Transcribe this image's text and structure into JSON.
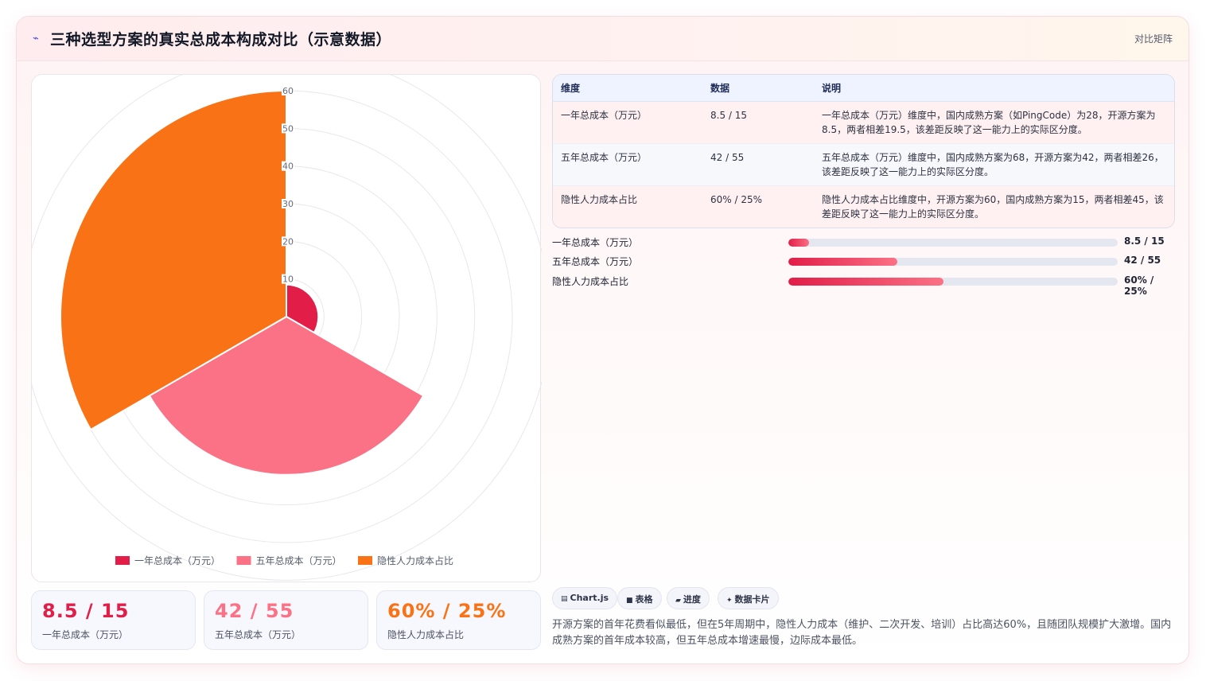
{
  "header": {
    "icon": "lightning-icon",
    "title": "三种选型方案的真实总成本构成对比（示意数据）",
    "badge": "对比矩阵"
  },
  "chart_data": {
    "type": "polarArea",
    "categories": [
      "一年总成本（万元）",
      "五年总成本（万元）",
      "隐性人力成本占比"
    ],
    "values": [
      8.5,
      42,
      60
    ],
    "colors": [
      "#e11d48",
      "#fb7185",
      "#f97316"
    ],
    "r_ticks": [
      "10",
      "20",
      "30",
      "40",
      "50",
      "60"
    ],
    "rlim": [
      0,
      60
    ],
    "legend": "bottom"
  },
  "table": {
    "headers": [
      "维度",
      "数据",
      "说明"
    ],
    "rows": [
      [
        "一年总成本（万元）",
        "8.5 / 15",
        "一年总成本（万元）维度中，国内成熟方案（如PingCode）为28，开源方案为8.5，两者相差19.5，该差距反映了这一能力上的实际区分度。"
      ],
      [
        "五年总成本（万元）",
        "42 / 55",
        "五年总成本（万元）维度中，国内成熟方案为68，开源方案为42，两者相差26，该差距反映了这一能力上的实际区分度。"
      ],
      [
        "隐性人力成本占比",
        "60% / 25%",
        "隐性人力成本占比维度中，开源方案为60，国内成熟方案为15，两者相差45，该差距反映了这一能力上的实际区分度。"
      ]
    ]
  },
  "progress": [
    {
      "label": "一年总成本（万元）",
      "value": "8.5 / 15",
      "fraction": 0.063
    },
    {
      "label": "五年总成本（万元）",
      "value": "42 / 55",
      "fraction": 0.33
    },
    {
      "label": "隐性人力成本占比",
      "value": "60% / 25%",
      "fraction": 0.47
    }
  ],
  "stats": [
    {
      "value": "8.5 / 15",
      "label": "一年总成本（万元）",
      "color": "#e11d48"
    },
    {
      "value": "42 / 55",
      "label": "五年总成本（万元）",
      "color": "#fb7185"
    },
    {
      "value": "60% / 25%",
      "label": "隐性人力成本占比",
      "color": "#f97316"
    }
  ],
  "chips": [
    {
      "icon": "chart-icon",
      "label": "Chart.js"
    },
    {
      "icon": "table-icon",
      "label": "表格"
    },
    {
      "icon": "progress-icon",
      "label": "进度"
    },
    {
      "icon": "sparkle-icon",
      "label": "数据卡片"
    }
  ],
  "summary": "开源方案的首年花费看似最低，但在5年周期中，隐性人力成本（维护、二次开发、培训）占比高达60%，且随团队规模扩大激增。国内成熟方案的首年成本较高，但五年总成本增速最慢，边际成本最低。"
}
